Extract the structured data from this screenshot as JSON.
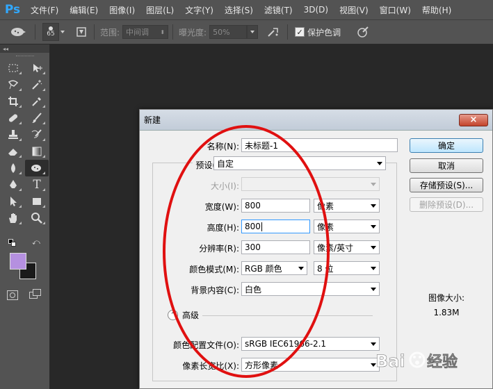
{
  "app": {
    "logo": "Ps"
  },
  "menu": [
    "文件(F)",
    "编辑(E)",
    "图像(I)",
    "图层(L)",
    "文字(Y)",
    "选择(S)",
    "滤镜(T)",
    "3D(D)",
    "视图(V)",
    "窗口(W)",
    "帮助(H)"
  ],
  "options": {
    "brush_size": "65",
    "range_label": "范围:",
    "range_value": "中间调",
    "exposure_label": "曝光度:",
    "exposure_value": "50%",
    "protect_tones_label": "保护色调",
    "protect_tones_checked": true
  },
  "dialog": {
    "title": "新建",
    "close": "×",
    "name_label": "名称(N):",
    "name_value": "未标题-1",
    "preset_label": "预设(P):",
    "preset_value": "自定",
    "size_label": "大小(I):",
    "size_value": "",
    "width_label": "宽度(W):",
    "width_value": "800",
    "width_unit": "像素",
    "height_label": "高度(H):",
    "height_value": "800",
    "height_unit": "像素",
    "resolution_label": "分辨率(R):",
    "resolution_value": "300",
    "resolution_unit": "像素/英寸",
    "color_mode_label": "颜色模式(M):",
    "color_mode_value": "RGB 颜色",
    "bit_depth_value": "8 位",
    "background_label": "背景内容(C):",
    "background_value": "白色",
    "advanced_label": "高级",
    "color_profile_label": "颜色配置文件(O):",
    "color_profile_value": "sRGB IEC61966-2.1",
    "pixel_aspect_label": "像素长宽比(X):",
    "pixel_aspect_value": "方形像素",
    "buttons": {
      "ok": "确定",
      "cancel": "取消",
      "save_preset": "存储预设(S)...",
      "delete_preset": "删除预设(D)..."
    },
    "image_size_label": "图像大小:",
    "image_size_value": "1.83M"
  },
  "watermark": "Bai 经验",
  "colors": {
    "foreground": "#b590e0",
    "background": "#1a1a1a",
    "annotation": "#e01010"
  }
}
